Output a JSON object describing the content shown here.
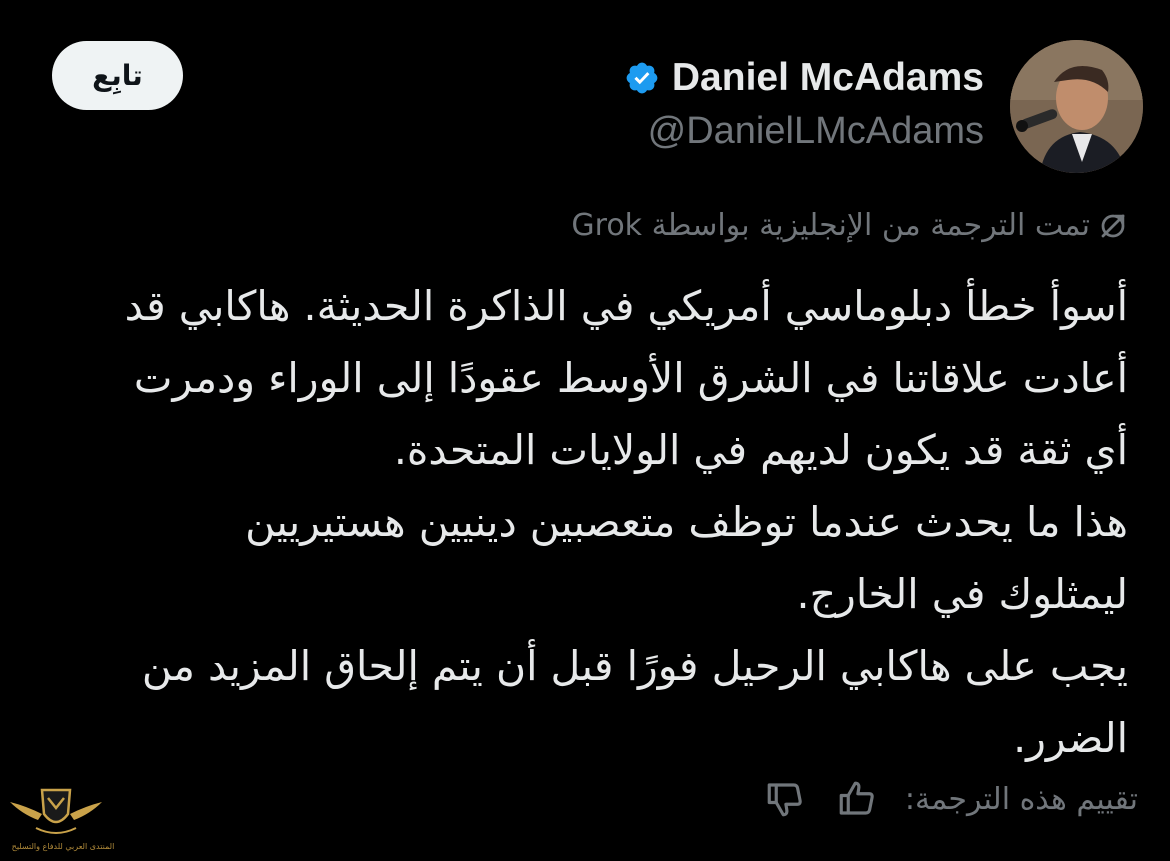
{
  "author": {
    "display_name": "Daniel McAdams",
    "handle": "@DanielLMcAdams",
    "verified_icon": "verified-badge-icon",
    "badge_color": "#1d9bf0"
  },
  "follow_button": {
    "label": "تابِع"
  },
  "translation_note": {
    "text": "تمت الترجمة من الإنجليزية بواسطة Grok",
    "icon": "translate-icon"
  },
  "tweet": {
    "lines": [
      "أسوأ خطأ دبلوماسي أمريكي في الذاكرة الحديثة. هاكابي قد",
      "أعادت علاقاتنا في الشرق الأوسط عقودًا إلى الوراء ودمرت",
      "أي ثقة قد يكون لديهم في الولايات المتحدة.",
      "هذا ما يحدث عندما توظف متعصبين دينيين هستيريين",
      "ليمثلوك في الخارج.",
      "يجب على هاكابي الرحيل فورًا قبل أن يتم إلحاق المزيد من",
      "الضرر."
    ]
  },
  "rating": {
    "label": "تقييم هذه الترجمة:",
    "thumbs_up_icon": "thumbs-up-icon",
    "thumbs_down_icon": "thumbs-down-icon"
  },
  "watermark": {
    "text": "المنتدى العربي للدفاع والتسليح"
  },
  "colors": {
    "background": "#000000",
    "primary_text": "#e7e9ea",
    "secondary_text": "#71767b",
    "follow_bg": "#eff3f4",
    "accent": "#1d9bf0"
  }
}
